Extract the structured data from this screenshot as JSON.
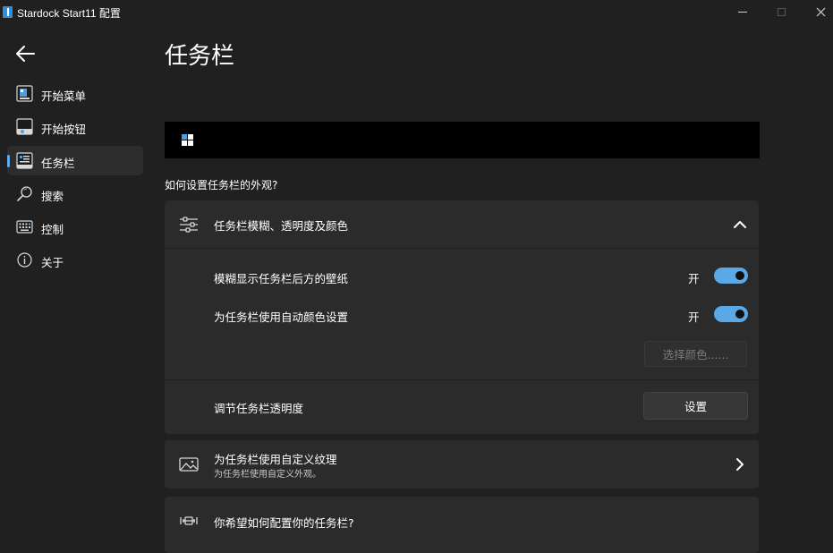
{
  "window": {
    "title": "Stardock Start11 配置"
  },
  "sidebar": {
    "items": [
      {
        "label": "开始菜单",
        "icon": "start-menu-icon"
      },
      {
        "label": "开始按钮",
        "icon": "start-button-icon"
      },
      {
        "label": "任务栏",
        "icon": "taskbar-icon",
        "active": true
      },
      {
        "label": "搜索",
        "icon": "search-icon"
      },
      {
        "label": "控制",
        "icon": "keyboard-icon"
      },
      {
        "label": "关于",
        "icon": "info-icon"
      }
    ]
  },
  "main": {
    "title": "任务栏",
    "question": "如何设置任务栏的外观?",
    "appearance_card": {
      "title": "任务栏模糊、透明度及颜色",
      "rows": [
        {
          "label": "模糊显示任务栏后方的壁纸",
          "state": "开",
          "on": true
        },
        {
          "label": "为任务栏使用自动颜色设置",
          "state": "开",
          "on": true
        }
      ],
      "choose_color_button": "选择颜色......",
      "transparency_label": "调节任务栏透明度",
      "transparency_button": "设置"
    },
    "texture_card": {
      "title": "为任务栏使用自定义纹理",
      "subtitle": "为任务栏使用自定义外观。"
    },
    "config_card": {
      "title": "你希望如何配置你的任务栏?"
    }
  },
  "colors": {
    "accent": "#5aa8e6",
    "background": "#202020",
    "card": "#2b2b2b"
  }
}
